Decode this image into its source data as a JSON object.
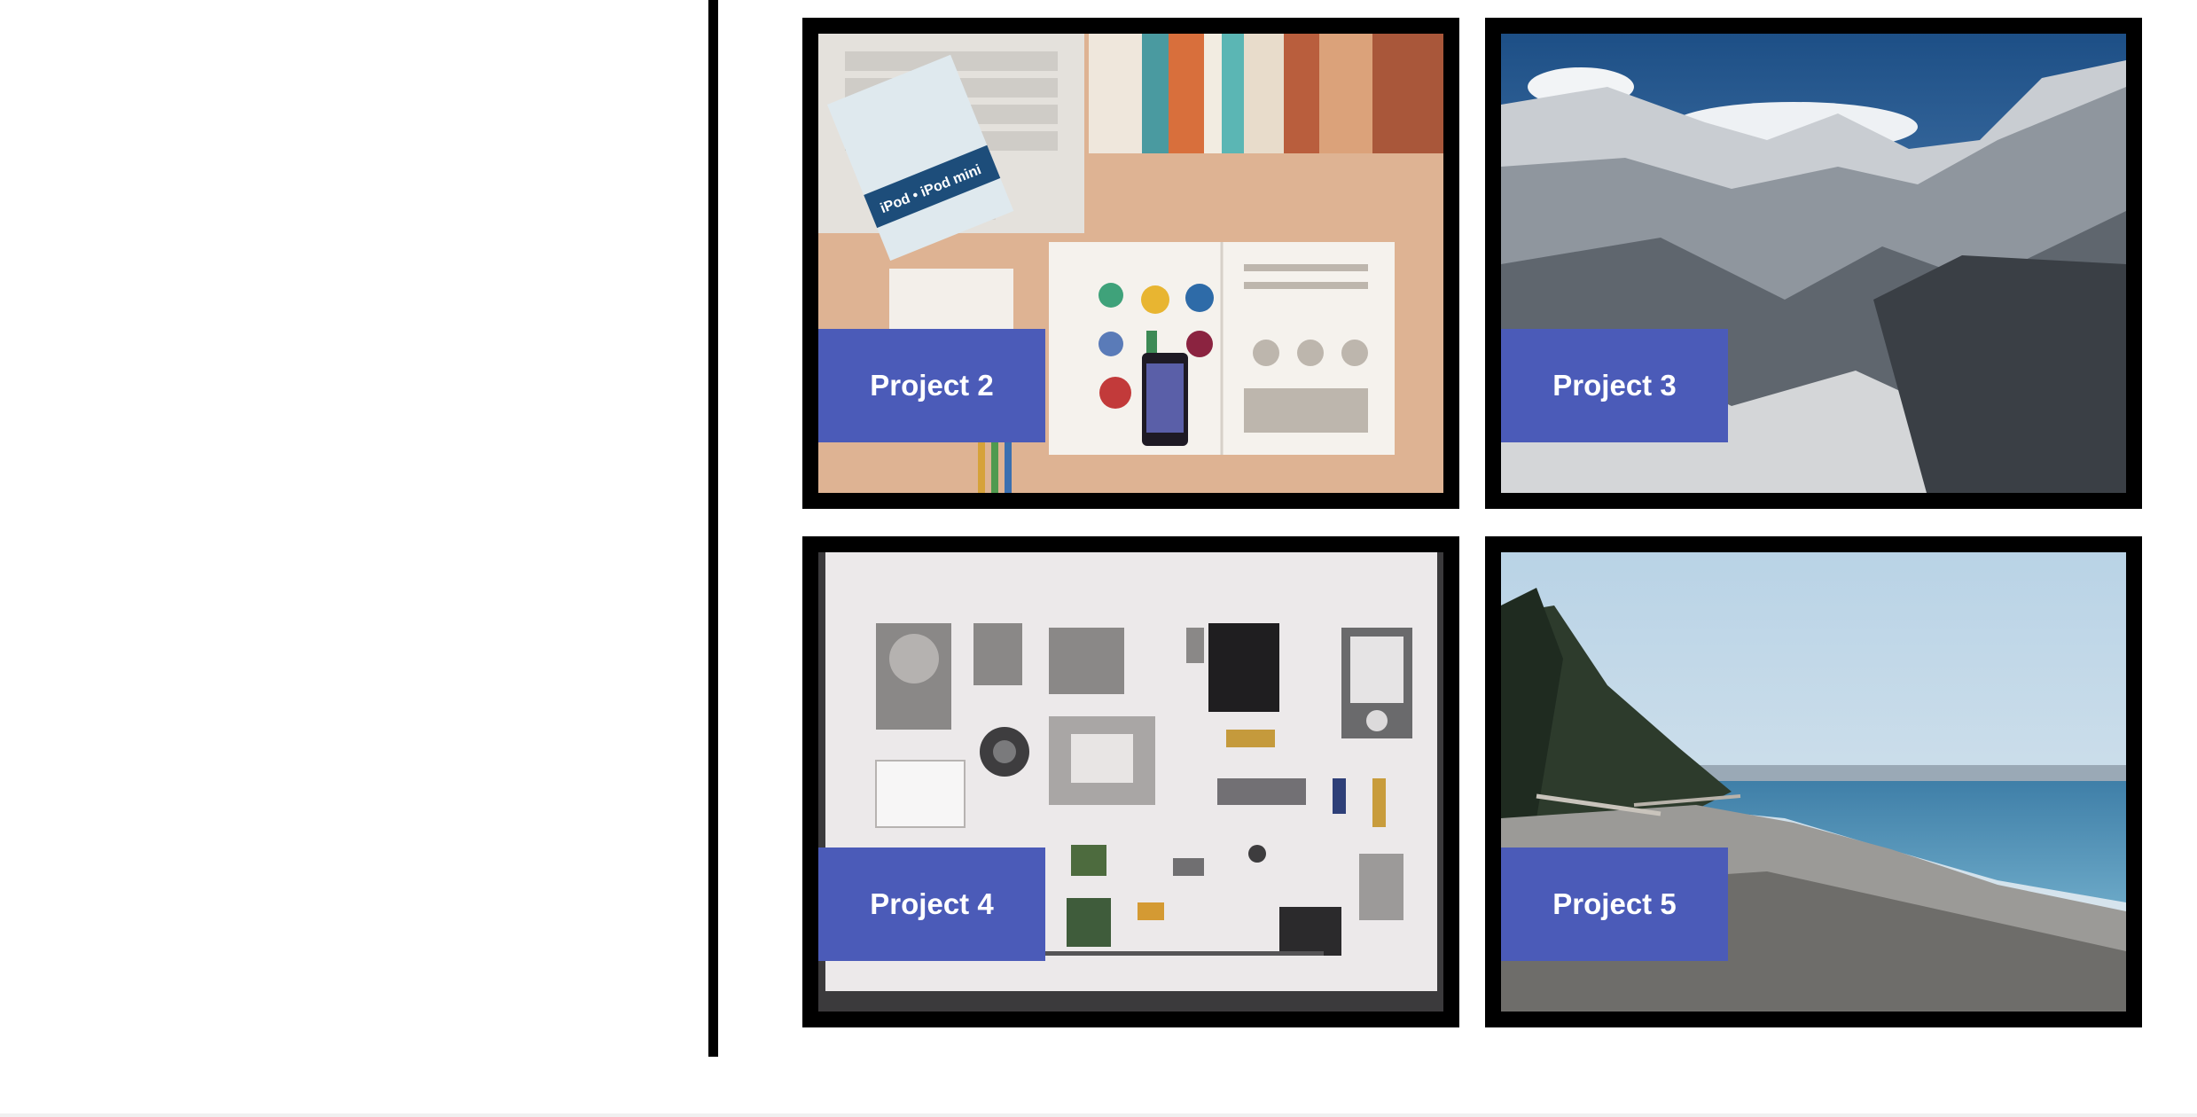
{
  "projects": [
    {
      "label": "Project 2",
      "image": "desk-workspace-photo"
    },
    {
      "label": "Project 3",
      "image": "snowy-mountains-photo"
    },
    {
      "label": "Project 4",
      "image": "disassembled-camera-parts-photo"
    },
    {
      "label": "Project 5",
      "image": "pebble-beach-photo"
    }
  ],
  "photo_text": {
    "ipod_booklet": "iPod • iPod mini"
  },
  "colors": {
    "label_bg": "#4b5bb8",
    "label_text": "#ffffff",
    "frame": "#000000",
    "divider": "#000000"
  }
}
